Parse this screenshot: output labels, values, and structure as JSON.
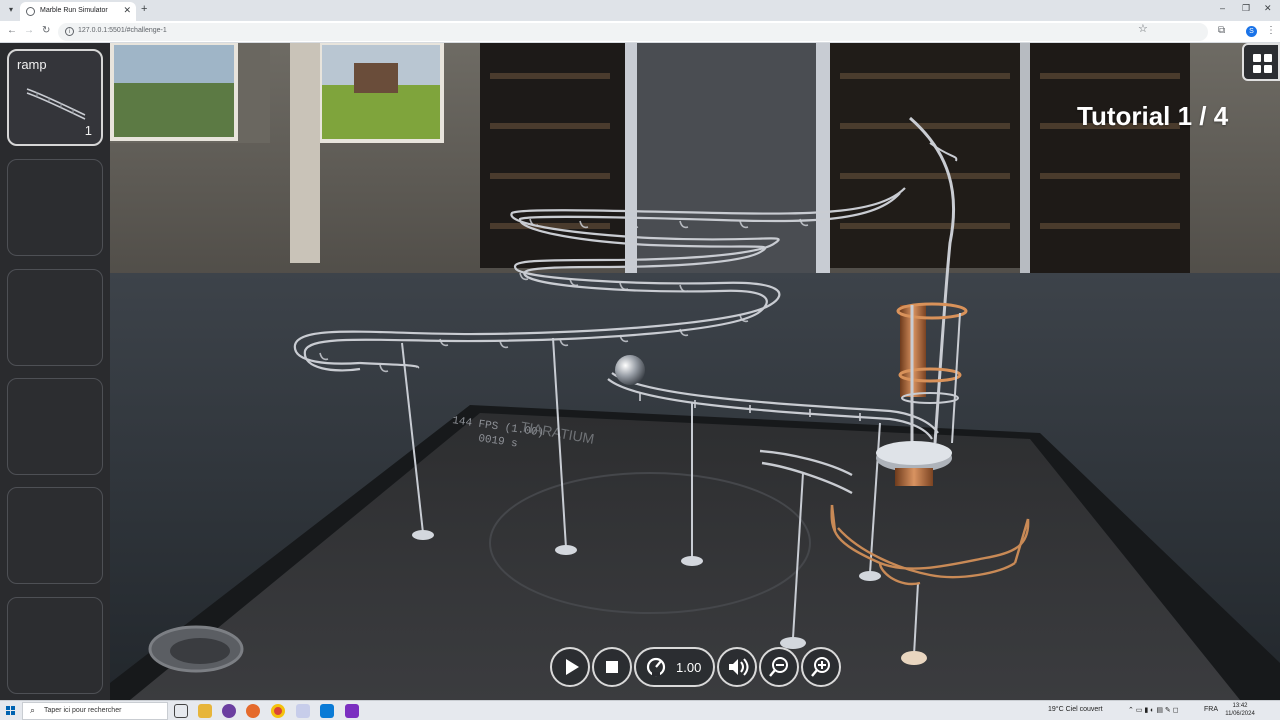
{
  "browser": {
    "tab_title": "Marble Run Simulator",
    "url": "127.0.0.1:5501/#challenge-1",
    "profile_initial": "S"
  },
  "sidebar": {
    "slots": [
      {
        "label": "ramp",
        "count": "1"
      }
    ]
  },
  "tutorial": {
    "label": "Tutorial 1 / 4"
  },
  "controls": {
    "speed": "1.00"
  },
  "scene": {
    "board_text_1": "144 FPS (1.00)",
    "board_text_2": "0019 s",
    "board_text_3": "TIARATIUM"
  },
  "taskbar": {
    "search_placeholder": "Taper ici pour rechercher",
    "weather": "19°C  Ciel couvert",
    "language": "FRA",
    "time": "13:42",
    "date": "11/06/2024"
  },
  "icons": {
    "play": "play-icon",
    "stop": "stop-icon",
    "speed": "speedometer-icon",
    "sound": "speaker-icon",
    "zoom_out": "zoom-out-icon",
    "zoom_in": "zoom-in-icon",
    "menu": "grid-icon"
  },
  "colors": {
    "panel_bg": "#2a2b2e",
    "panel_border": "#4e5055",
    "control_border": "#d9d9d9",
    "rail_silver": "#c9ccd2",
    "rail_copper": "#c88750"
  }
}
